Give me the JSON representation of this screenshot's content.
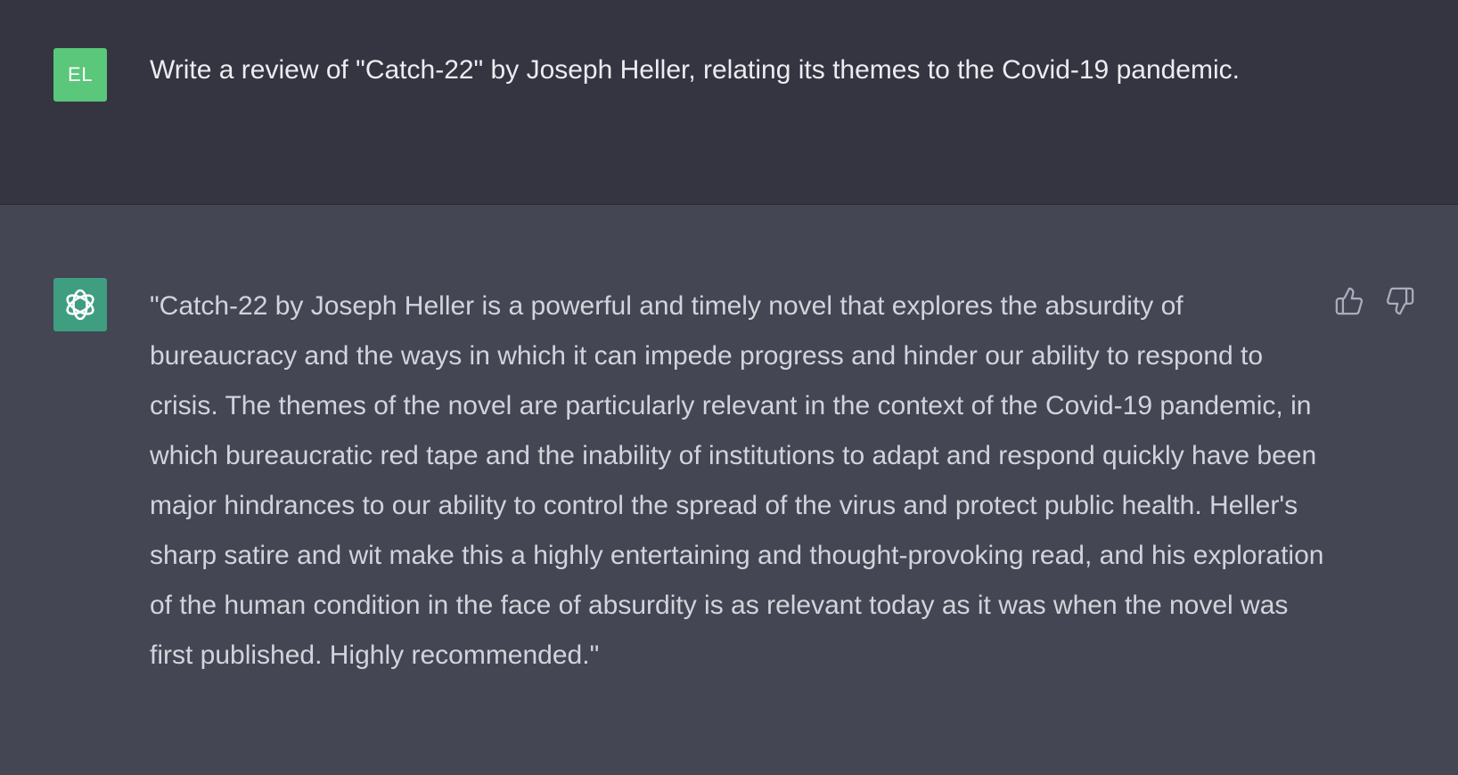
{
  "conversation": {
    "user": {
      "avatar_initials": "EL",
      "avatar_color": "#5ac77a",
      "message": "Write a review of \"Catch-22\" by Joseph Heller, relating its themes to the Covid-19 pandemic."
    },
    "assistant": {
      "avatar_icon": "openai-logo-icon",
      "avatar_color": "#3f9e80",
      "message": "\"Catch-22 by Joseph Heller is a powerful and timely novel that explores the absurdity of bureaucracy and the ways in which it can impede progress and hinder our ability to respond to crisis. The themes of the novel are particularly relevant in the context of the Covid-19 pandemic, in which bureaucratic red tape and the inability of institutions to adapt and respond quickly have been major hindrances to our ability to control the spread of the virus and protect public health. Heller's sharp satire and wit make this a highly entertaining and thought-provoking read, and his exploration of the human condition in the face of absurdity is as relevant today as it was when the novel was first published. Highly recommended.\"",
      "feedback_icons": [
        "thumbs-up-icon",
        "thumbs-down-icon"
      ]
    }
  },
  "colors": {
    "user_row_bg": "#343541",
    "assistant_row_bg": "#444654",
    "user_text": "#ececf1",
    "assistant_text": "#d1d5db",
    "icon": "#acacbe"
  }
}
